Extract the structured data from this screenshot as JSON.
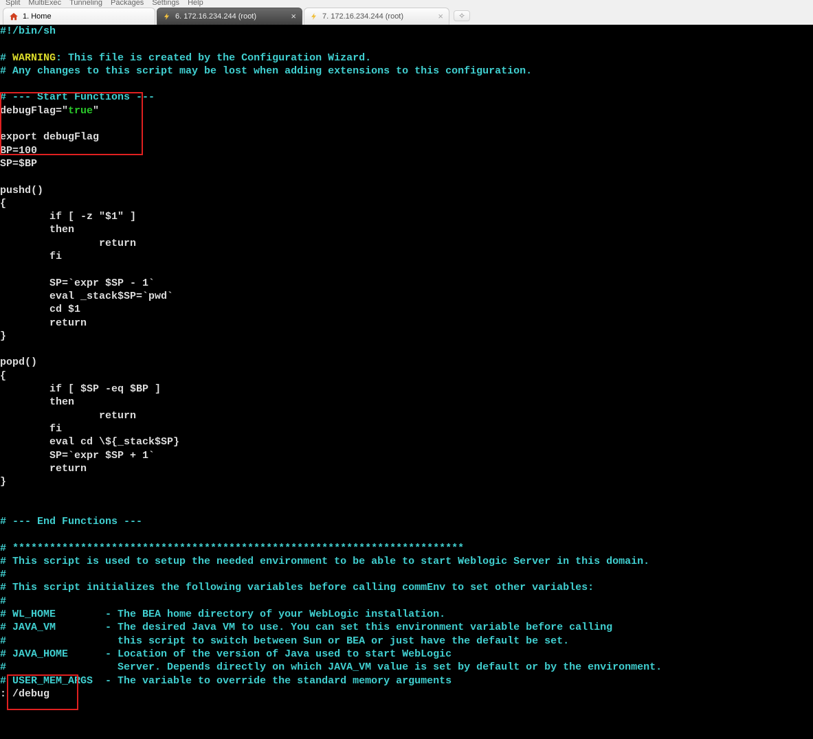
{
  "menu": {
    "items": [
      "Split",
      "MultiExec",
      "Tunneling",
      "Packages",
      "Settings",
      "Help"
    ]
  },
  "tabs": {
    "home": {
      "label": "1. Home"
    },
    "active": {
      "label": "6. 172.16.234.244 (root)"
    },
    "inactive": {
      "label": "7. 172.16.234.244 (root)"
    }
  },
  "term": {
    "l01": "#!/bin/sh",
    "l02": "",
    "l03a": "# ",
    "l03w": "WARNING",
    "l03b": ": This file is created by the Configuration Wizard.",
    "l04": "# Any changes to this script may be lost when adding extensions to this configuration.",
    "l05": "",
    "l06": "# --- Start Functions ---",
    "l07a": "debugFlag=\"",
    "l07b": "true",
    "l07c": "\"",
    "l08": "",
    "l09": "export debugFlag",
    "l10": "BP=100",
    "l11": "SP=$BP",
    "l12": "",
    "l13": "pushd()",
    "l14": "{",
    "l15": "        if [ -z \"$1\" ]",
    "l16": "        then",
    "l17": "                return",
    "l18": "        fi",
    "l19": "",
    "l20": "        SP=`expr $SP - 1`",
    "l21": "        eval _stack$SP=`pwd`",
    "l22": "        cd $1",
    "l23": "        return",
    "l24": "}",
    "l25": "",
    "l26": "popd()",
    "l27": "{",
    "l28": "        if [ $SP -eq $BP ]",
    "l29": "        then",
    "l30": "                return",
    "l31": "        fi",
    "l32": "        eval cd \\${_stack$SP}",
    "l33": "        SP=`expr $SP + 1`",
    "l34": "        return",
    "l35": "}",
    "l36": "",
    "l37": "",
    "l38": "# --- End Functions ---",
    "l39": "",
    "l40": "# *************************************************************************",
    "l41": "# This script is used to setup the needed environment to be able to start Weblogic Server in this domain.",
    "l42": "#",
    "l43": "# This script initializes the following variables before calling commEnv to set other variables:",
    "l44": "#",
    "l45": "# WL_HOME        - The BEA home directory of your WebLogic installation.",
    "l46": "# JAVA_VM        - The desired Java VM to use. You can set this environment variable before calling",
    "l47": "#                  this script to switch between Sun or BEA or just have the default be set.",
    "l48": "# JAVA_HOME      - Location of the version of Java used to start WebLogic",
    "l49": "#                  Server. Depends directly on which JAVA_VM value is set by default or by the environment.",
    "l50": "# USER_MEM_ARGS  - The variable to override the standard memory arguments",
    "l51": ": /debug"
  }
}
